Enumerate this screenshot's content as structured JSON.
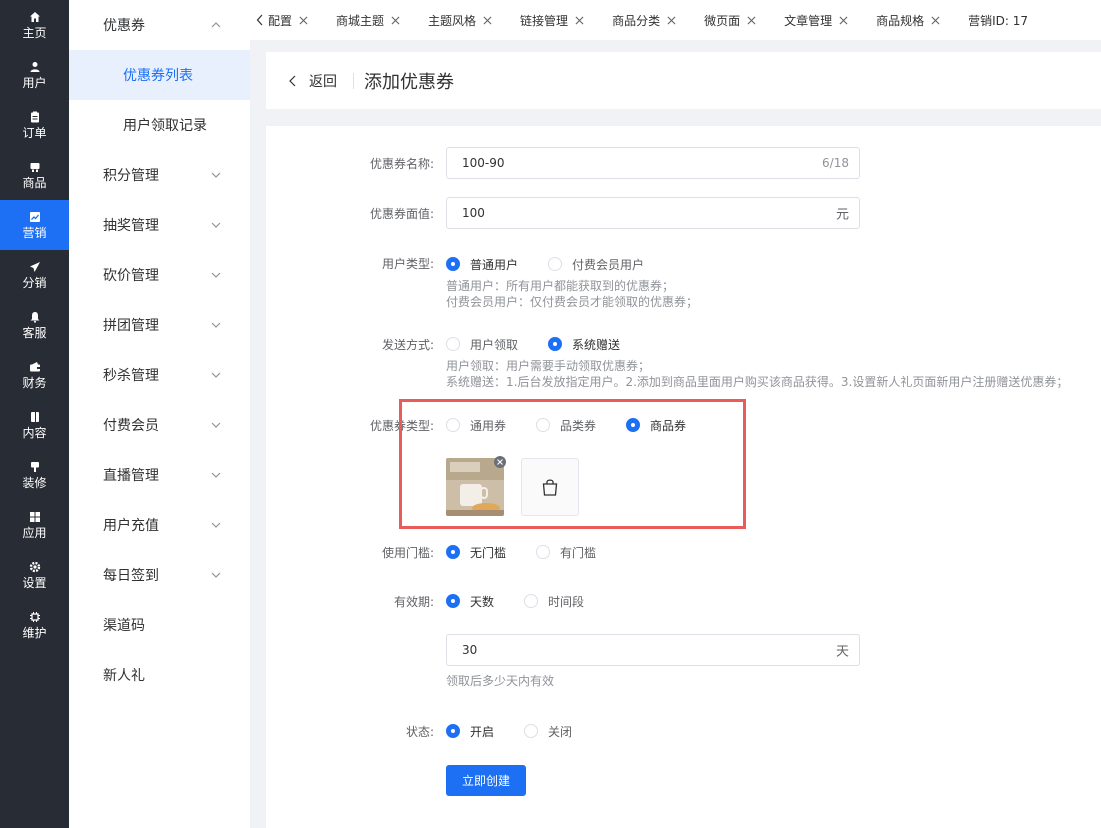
{
  "nav": [
    {
      "label": "主页",
      "icon": "home-icon"
    },
    {
      "label": "用户",
      "icon": "user-icon"
    },
    {
      "label": "订单",
      "icon": "order-icon"
    },
    {
      "label": "商品",
      "icon": "product-icon"
    },
    {
      "label": "营销",
      "icon": "marketing-icon",
      "active": true
    },
    {
      "label": "分销",
      "icon": "send-icon"
    },
    {
      "label": "客服",
      "icon": "bell-icon"
    },
    {
      "label": "财务",
      "icon": "wallet-icon"
    },
    {
      "label": "内容",
      "icon": "book-icon"
    },
    {
      "label": "装修",
      "icon": "brush-icon"
    },
    {
      "label": "应用",
      "icon": "apps-icon"
    },
    {
      "label": "设置",
      "icon": "gear-icon"
    },
    {
      "label": "维护",
      "icon": "chip-icon"
    }
  ],
  "submenu": {
    "group_open": "优惠券",
    "children": [
      "优惠券列表",
      "用户领取记录"
    ],
    "items": [
      "积分管理",
      "抽奖管理",
      "砍价管理",
      "拼团管理",
      "秒杀管理",
      "付费会员",
      "直播管理",
      "用户充值",
      "每日签到"
    ],
    "plain_items": [
      "渠道码",
      "新人礼"
    ]
  },
  "tabs": [
    "配置",
    "商城主题",
    "主题风格",
    "链接管理",
    "商品分类",
    "微页面",
    "文章管理",
    "商品规格",
    "营销ID: 17"
  ],
  "header": {
    "back": "返回",
    "title": "添加优惠券"
  },
  "form": {
    "name_label": "优惠券名称:",
    "name_value": "100-90",
    "name_count": "6/18",
    "face_label": "优惠券面值:",
    "face_value": "100",
    "face_unit": "元",
    "user_type_label": "用户类型:",
    "user_type_options": [
      "普通用户",
      "付费会员用户"
    ],
    "user_type_help": [
      "普通用户：所有用户都能获取到的优惠券；",
      "付费会员用户：仅付费会员才能领取的优惠券；"
    ],
    "send_label": "发送方式:",
    "send_options": [
      "用户领取",
      "系统赠送"
    ],
    "send_help": [
      "用户领取：用户需要手动领取优惠券；",
      "系统赠送：1.后台发放指定用户。2.添加到商品里面用户购买该商品获得。3.设置新人礼页面新用户注册赠送优惠券；"
    ],
    "coupon_type_label": "优惠券类型:",
    "coupon_type_options": [
      "通用券",
      "品类券",
      "商品券"
    ],
    "threshold_label": "使用门槛:",
    "threshold_options": [
      "无门槛",
      "有门槛"
    ],
    "validity_label": "有效期:",
    "validity_options": [
      "天数",
      "时间段"
    ],
    "days_value": "30",
    "days_unit": "天",
    "days_help": "领取后多少天内有效",
    "status_label": "状态:",
    "status_options": [
      "开启",
      "关闭"
    ],
    "submit": "立即创建"
  },
  "colors": {
    "primary": "#1d6ff3",
    "nav_bg": "#282c34",
    "highlight": "#e95c5c"
  }
}
